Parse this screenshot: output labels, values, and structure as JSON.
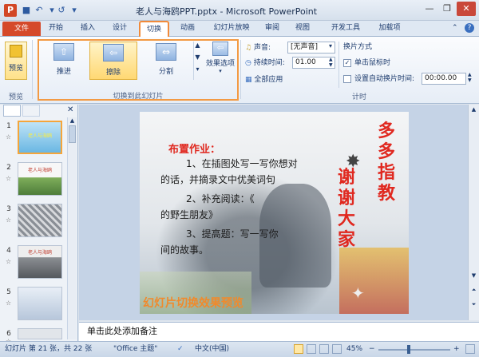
{
  "window": {
    "title": "老人与海鸥PPT.pptx - Microsoft PowerPoint",
    "app_icon": "P",
    "quick_access": [
      "save-icon",
      "undo-icon",
      "redo-icon",
      "customize-icon"
    ]
  },
  "tabs": [
    {
      "label": "文件"
    },
    {
      "label": "开始"
    },
    {
      "label": "插入"
    },
    {
      "label": "设计"
    },
    {
      "label": "切换"
    },
    {
      "label": "动画"
    },
    {
      "label": "幻灯片放映"
    },
    {
      "label": "审阅"
    },
    {
      "label": "视图"
    },
    {
      "label": "开发工具"
    },
    {
      "label": "加载项"
    }
  ],
  "ribbon": {
    "preview_group": {
      "button": "预览",
      "label": "预览"
    },
    "transitions_group": {
      "items": [
        {
          "label": "推进",
          "icon": "push-transition-icon"
        },
        {
          "label": "擦除",
          "icon": "wipe-transition-icon"
        },
        {
          "label": "分割",
          "icon": "split-transition-icon"
        }
      ],
      "effects_label": "效果选项",
      "label": "切换到此幻灯片"
    },
    "timing_group": {
      "sound_label": "声音:",
      "sound_value": "[无声音]",
      "duration_label": "持续时间:",
      "duration_value": "01.00",
      "apply_all": "全部应用",
      "advance_title": "换片方式",
      "on_click": "单击鼠标时",
      "on_click_checked": true,
      "after_time": "设置自动换片时间:",
      "after_time_checked": false,
      "after_value": "00:00.00",
      "label": "计时"
    }
  },
  "thumbnails": [
    {
      "num": "1",
      "star": "☆",
      "caption": "老人与海鸥"
    },
    {
      "num": "2",
      "star": "☆",
      "caption": "老人与海鸥"
    },
    {
      "num": "3",
      "star": "☆",
      "caption": ""
    },
    {
      "num": "4",
      "star": "☆",
      "caption": "老人与海鸥"
    },
    {
      "num": "5",
      "star": "☆",
      "caption": ""
    },
    {
      "num": "6",
      "star": "☆",
      "caption": ""
    }
  ],
  "slide": {
    "heading": "布置作业：",
    "line1": "1、在插图处写一写你想对",
    "line1b": "的话，并摘录文中优美词句",
    "line2": "2、补充阅读：《",
    "line2b": "的野生朋友》",
    "line3": "3、提高题：写一写你",
    "line3b": "间的故事。",
    "side_text": "多多指教",
    "side_text2": "谢谢大家",
    "preview_caption": "幻灯片切换效果预览"
  },
  "notes_placeholder": "单击此处添加备注",
  "status": {
    "slide_info": "幻灯片 第 21 张，共 22 张",
    "theme": "\"Office 主题\"",
    "language": "中文(中国)",
    "zoom": "45%"
  }
}
